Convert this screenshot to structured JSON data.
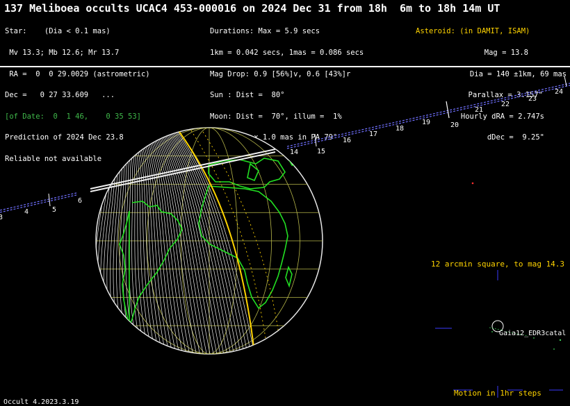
{
  "title": "137 Meliboea occults UCAC4 453-000016 on 2024 Dec 31 from 18h  6m to 18h 14m UT",
  "star_info": [
    "Star:    (Dia < 0.1 mas)",
    " Mv 13.3; Mb 12.6; Mr 13.7",
    " RA =  0  0 29.0029 (astrometric)",
    "Dec =   0 27 33.609   ...",
    "[of Date:  0  1 46,    0 35 53]",
    "Prediction of 2024 Dec 23.8",
    "Reliable not available"
  ],
  "event_info": [
    "Durations: Max = 5.9 secs",
    "1km = 0.042 secs, 1mas = 0.086 secs",
    "Mag Drop: 0.9 [56%]v, 0.6 [43%]r",
    "Sun : Dist =  80°",
    "Moon: Dist =  70°, illum =  1%",
    "Error 3.0 x 1.0 mas in PA 79°"
  ],
  "asteroid_info": [
    "Asteroid: (in DAMIT, ISAM)",
    "Mag = 13.8",
    "Dia = 140 ±1km, 69 mas",
    "Parallax = 3.157\"",
    "Hourly dRA = 2.747s",
    "dDec =  9.25\""
  ],
  "path_hour_labels": [
    "3",
    "4",
    "5",
    "6",
    "14",
    "15",
    "16",
    "17",
    "18",
    "19",
    "20",
    "21",
    "22",
    "23",
    "24"
  ],
  "star_chart": {
    "caption": "12 arcmin square, to mag 14.3",
    "star_label": "Gaia12_EDR3catal",
    "motion_label": "Motion in 1hr steps"
  },
  "footer": "Occult 4.2023.3.19",
  "colors": {
    "background": "#000000",
    "text": "#ffffff",
    "highlight": "#ffd400",
    "coastline": "#22e022",
    "graticule": "#b8b84a",
    "shadow_path": "#f2f2f2",
    "track": "#7070ff",
    "star_chart_marks": "#3a3aff"
  }
}
